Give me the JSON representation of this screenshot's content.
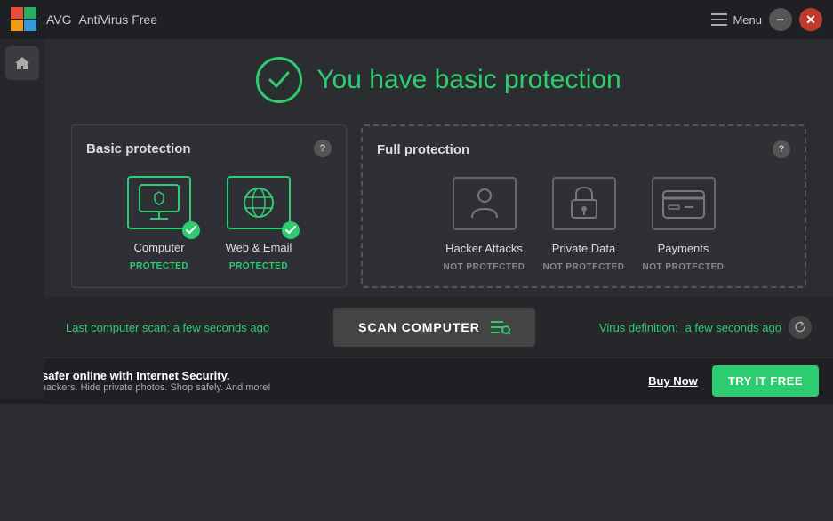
{
  "app": {
    "name": "AntiVirus Free",
    "brand": "AVG"
  },
  "titlebar": {
    "menu_label": "Menu",
    "minimize_label": "−",
    "close_label": "✕"
  },
  "header": {
    "status_text": "You have basic protection"
  },
  "basic_protection": {
    "title": "Basic protection",
    "help": "?",
    "items": [
      {
        "name": "Computer",
        "status": "PROTECTED",
        "protected": true
      },
      {
        "name": "Web & Email",
        "status": "PROTECTED",
        "protected": true
      }
    ]
  },
  "full_protection": {
    "title": "Full protection",
    "help": "?",
    "items": [
      {
        "name": "Hacker Attacks",
        "status": "NOT PROTECTED",
        "protected": false
      },
      {
        "name": "Private Data",
        "status": "NOT PROTECTED",
        "protected": false
      },
      {
        "name": "Payments",
        "status": "NOT PROTECTED",
        "protected": false
      }
    ]
  },
  "scan_bar": {
    "last_scan_label": "Last computer scan:",
    "last_scan_value": "a few seconds ago",
    "scan_button": "SCAN COMPUTER",
    "virus_def_label": "Virus definition:",
    "virus_def_value": "a few seconds ago"
  },
  "promo_bar": {
    "headline": "Stay safer online with Internet Security.",
    "subtext": "Block hackers. Hide private photos. Shop safely. And more!",
    "buy_label": "Buy Now",
    "try_label": "TRY IT FREE"
  }
}
